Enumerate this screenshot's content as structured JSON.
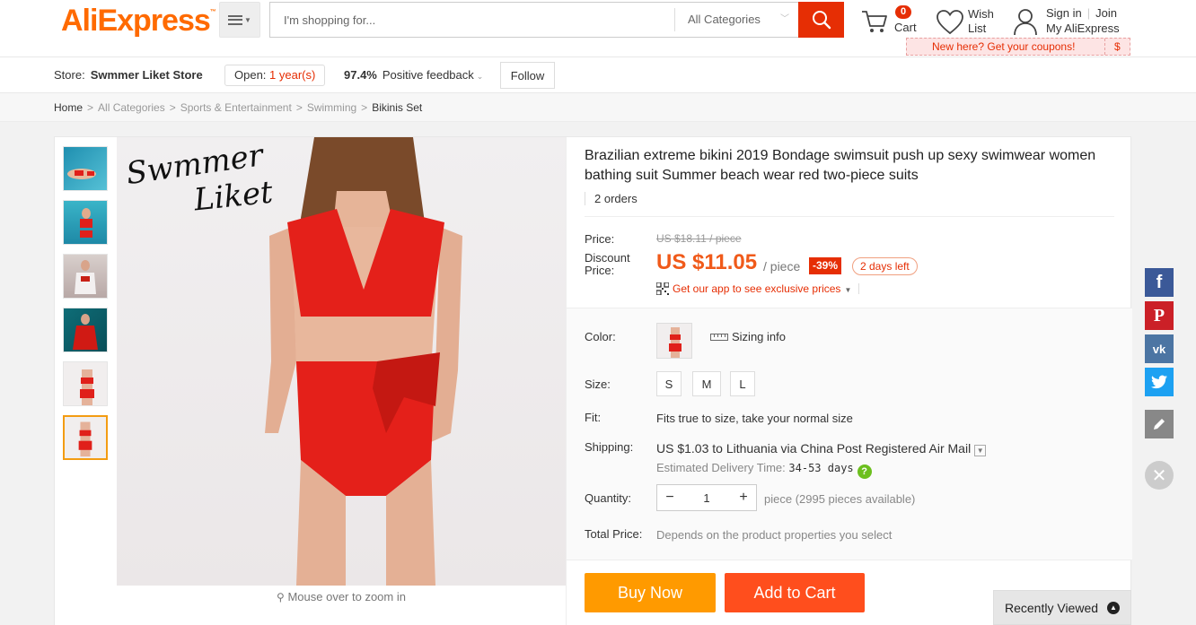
{
  "header": {
    "logo": "AliExpress",
    "logo_tm": "™",
    "search_placeholder": "I'm shopping for...",
    "category": "All Categories",
    "cart_count": "0",
    "cart_label": "Cart",
    "wish_line1": "Wish",
    "wish_line2": "List",
    "sign_in": "Sign in",
    "join": "Join",
    "my_account": "My AliExpress",
    "coupon_text": "New here? Get your coupons!",
    "coupon_symbol": "$"
  },
  "store": {
    "label": "Store:",
    "name": "Swmmer Liket Store",
    "open_label": "Open:",
    "open_years": "1 year(s)",
    "feedback_pct": "97.4%",
    "feedback_label": "Positive feedback",
    "follow": "Follow"
  },
  "breadcrumb": {
    "items": [
      "Home",
      "All Categories",
      "Sports & Entertainment",
      "Swimming"
    ],
    "current": "Bikinis Set",
    "separator": ">"
  },
  "gallery": {
    "brand_line1": "Swmmer",
    "brand_line2": "Liket",
    "zoom_hint": "Mouse over to zoom in"
  },
  "product": {
    "title": "Brazilian extreme bikini 2019 Bondage swimsuit push up sexy swimwear women bathing suit Summer beach wear red two-piece suits",
    "orders": "2 orders",
    "price_label": "Price:",
    "old_price": "US $18.11 / piece",
    "discount_label_1": "Discount",
    "discount_label_2": "Price:",
    "new_price": "US $11.05",
    "unit": "/ piece",
    "discount": "-39%",
    "days_left": "2 days left",
    "app_link": "Get our app to see exclusive prices"
  },
  "props": {
    "color_label": "Color:",
    "sizing_info": "Sizing info",
    "size_label": "Size:",
    "sizes": [
      "S",
      "M",
      "L"
    ],
    "fit_label": "Fit:",
    "fit_value": "Fits true to size, take your normal size",
    "shipping_label": "Shipping:",
    "shipping_value": "US $1.03 to Lithuania via China Post Registered Air Mail",
    "delivery_label": "Estimated Delivery Time:",
    "delivery_value": "34-53 days",
    "quantity_label": "Quantity:",
    "quantity_value": "1",
    "quantity_minus": "−",
    "quantity_plus": "+",
    "available": "piece (2995 pieces available)",
    "total_label": "Total Price:",
    "total_value": "Depends on the product properties you select"
  },
  "actions": {
    "buy_now": "Buy Now",
    "add_to_cart": "Add to Cart"
  },
  "recently_viewed": "Recently Viewed",
  "colors": {
    "brand_orange": "#ff6a00",
    "accent_red": "#e62e04",
    "buy_orange": "#ff9a00",
    "cart_red": "#ff4e1d",
    "facebook": "#3b5998",
    "pinterest": "#cb2027",
    "vk": "#4c75a3",
    "twitter": "#1da1f2"
  }
}
